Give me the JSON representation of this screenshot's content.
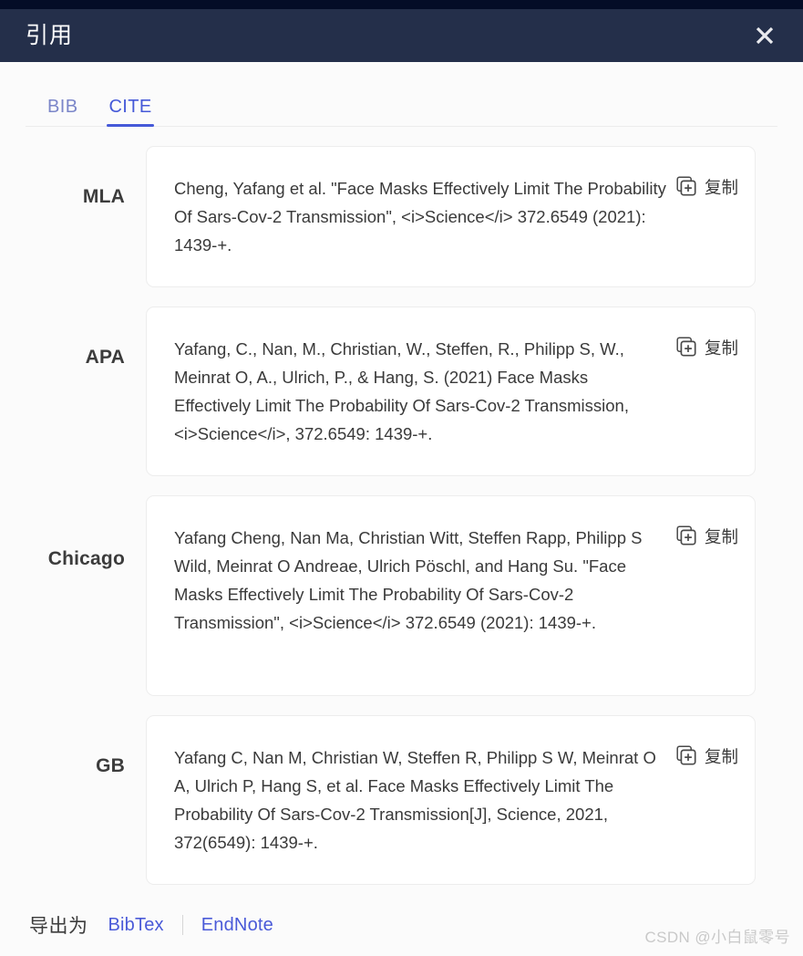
{
  "window": {
    "title": "引用",
    "close_icon": "close-icon"
  },
  "tabs": [
    {
      "label": "BIB",
      "active": false
    },
    {
      "label": "CITE",
      "active": true
    }
  ],
  "citations": [
    {
      "style": "MLA",
      "text": "Cheng, Yafang et al. \"Face Masks Effectively Limit The Probability Of Sars-Cov-2 Transmission\", <i>Science</i> 372.6549 (2021): 1439-+.",
      "copy_label": "复制",
      "copy_icon": "copy-icon"
    },
    {
      "style": "APA",
      "text": "Yafang, C., Nan, M., Christian, W., Steffen, R., Philipp S, W., Meinrat O, A., Ulrich, P., & Hang, S. (2021) Face Masks Effectively Limit The Probability Of Sars-Cov-2 Transmission, <i>Science</i>, 372.6549: 1439-+.",
      "copy_label": "复制",
      "copy_icon": "copy-icon"
    },
    {
      "style": "Chicago",
      "text": "Yafang Cheng, Nan Ma, Christian Witt, Steffen Rapp, Philipp S Wild, Meinrat O Andreae, Ulrich Pöschl, and Hang Su. \"Face Masks Effectively Limit The Probability Of Sars-Cov-2 Transmission\", <i>Science</i> 372.6549 (2021): 1439-+.",
      "copy_label": "复制",
      "copy_icon": "copy-icon"
    },
    {
      "style": "GB",
      "text": "Yafang C, Nan M, Christian W, Steffen R, Philipp S W, Meinrat O A, Ulrich P, Hang S, et al. Face Masks Effectively Limit The Probability Of Sars-Cov-2 Transmission[J], Science, 2021, 372(6549): 1439-+.",
      "copy_label": "复制",
      "copy_icon": "copy-icon"
    }
  ],
  "export": {
    "label": "导出为",
    "links": [
      {
        "label": "BibTex"
      },
      {
        "label": "EndNote"
      }
    ]
  },
  "watermark": "CSDN @小白鼠零号",
  "colors": {
    "header_bg": "#242f4a",
    "titlebar_strip": "#040d27",
    "accent": "#4559d8",
    "tab_inactive": "#7b86c9",
    "page_bg": "#fbfbfb",
    "card_bg": "#ffffff",
    "card_border": "#ededed",
    "text": "#3a3a3a",
    "watermark": "#c9c9c9"
  }
}
